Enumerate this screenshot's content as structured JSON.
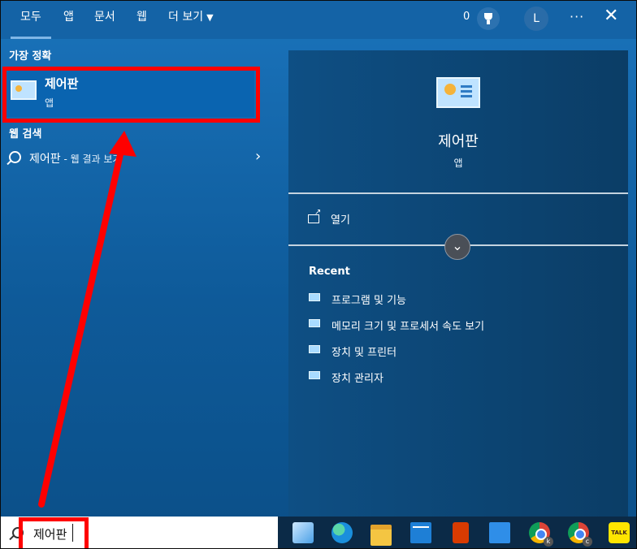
{
  "tabs": [
    "모두",
    "앱",
    "문서",
    "웹",
    "더 보기"
  ],
  "header": {
    "count": "0",
    "avatar_initial": "L",
    "more_label": "···",
    "close_label": "✕"
  },
  "left": {
    "best_match_label": "가장 정확",
    "best_match": {
      "title": "제어판",
      "subtitle": "앱"
    },
    "web_search_label": "웹 검색",
    "web_search": {
      "query": "제어판",
      "suffix": " - 웹 결과 보기"
    }
  },
  "right": {
    "title": "제어판",
    "subtitle": "앱",
    "open_label": "열기",
    "recent_label": "Recent",
    "recent": [
      "프로그램 및 기능",
      "메모리 크기 및 프로세서 속도 보기",
      "장치 및 프린터",
      "장치 관리자"
    ]
  },
  "search": {
    "value": "제어판"
  },
  "taskbar": {
    "talk_label": "TALK",
    "badge1": "k",
    "badge2": "c"
  },
  "colors": {
    "annotation": "#ff0000",
    "accent": "#1463a6"
  }
}
